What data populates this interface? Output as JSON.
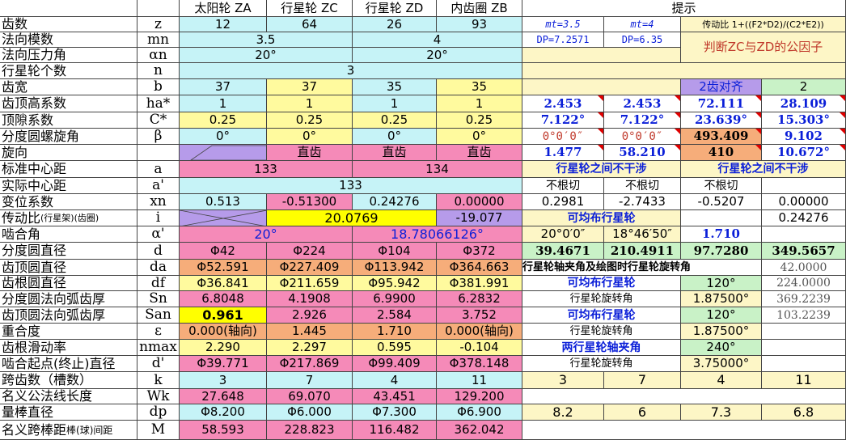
{
  "header": {
    "label": "",
    "symbol": "",
    "sun": "太阳轮 ZA",
    "planet_c": "行星轮 ZC",
    "planet_d": "行星轮 ZD",
    "ring": "内齿圈 ZB",
    "hint": "提示"
  },
  "params": {
    "z": {
      "label": "齿数",
      "symbol": "z",
      "sun": "12",
      "planet_c": "64",
      "planet_d": "26",
      "ring": "93"
    },
    "mn": {
      "label": "法向模数",
      "symbol": "mn",
      "v1": "3.5",
      "v2": "4"
    },
    "an": {
      "label": "法向压力角",
      "symbol": "αn",
      "v1": "20°",
      "v2": "20°"
    },
    "n": {
      "label": "行星轮个数",
      "symbol": "n",
      "v": "3"
    },
    "b": {
      "label": "齿宽",
      "symbol": "b",
      "sun": "37",
      "planet_c": "37",
      "planet_d": "35",
      "ring": "35"
    },
    "ha": {
      "label": "齿顶高系数",
      "symbol": "ha*",
      "sun": "1",
      "planet_c": "1",
      "planet_d": "1",
      "ring": "1"
    },
    "c": {
      "label": "顶隙系数",
      "symbol": "C*",
      "sun": "0.25",
      "planet_c": "0.25",
      "planet_d": "0.25",
      "ring": "0.25"
    },
    "beta": {
      "label": "分度圆螺旋角",
      "symbol": "β",
      "sun": "0°",
      "planet_c": "0°",
      "planet_d": "0°",
      "ring": "0°"
    },
    "dir": {
      "label": "旋向",
      "symbol": "",
      "planet_c": "直齿",
      "planet_d": "直齿",
      "ring": "直齿",
      "sun2": "直齿"
    },
    "a": {
      "label": "标准中心距",
      "symbol": "a",
      "v1": "133",
      "v2": "134"
    },
    "a2": {
      "label": "实际中心距",
      "symbol": "a'",
      "v": "133"
    },
    "xn": {
      "label": "变位系数",
      "symbol": "xn",
      "sun": "0.513",
      "planet_c": "-0.51300",
      "planet_d": "0.24276",
      "ring": "0.00000"
    },
    "i": {
      "label": "传动比",
      "label_small": "(行星架)(齿圈)",
      "symbol": "i",
      "v1": "20.0769",
      "v2": "-19.077"
    },
    "aw": {
      "label": "啮合角",
      "symbol": "α'",
      "v1": "20°",
      "v2": "18.78066126°"
    },
    "d": {
      "label": "分度圆直径",
      "symbol": "d",
      "sun": "Φ42",
      "planet_c": "Φ224",
      "planet_d": "Φ104",
      "ring": "Φ372"
    },
    "da": {
      "label": "齿顶圆直径",
      "symbol": "da",
      "sun": "Φ52.591",
      "planet_c": "Φ227.409",
      "planet_d": "Φ113.942",
      "ring": "Φ364.663"
    },
    "df": {
      "label": "齿根圆直径",
      "symbol": "df",
      "sun": "Φ36.841",
      "planet_c": "Φ211.659",
      "planet_d": "Φ95.942",
      "ring": "Φ381.991"
    },
    "sn": {
      "label": "分度圆法向弧齿厚",
      "symbol": "Sn",
      "sun": "6.8048",
      "planet_c": "4.1908",
      "planet_d": "6.9900",
      "ring": "6.2832"
    },
    "san": {
      "label": "齿顶圆法向弧齿厚",
      "symbol": "San",
      "sun": "0.961",
      "planet_c": "2.926",
      "planet_d": "2.584",
      "ring": "3.752"
    },
    "eps": {
      "label": "重合度",
      "symbol": "ε",
      "sun": "0.000(轴向)",
      "planet_c": "1.445",
      "planet_d": "1.710",
      "ring": "0.000(轴向)"
    },
    "nmax": {
      "label": "齿根滑动率",
      "symbol": "nmax",
      "sun": "2.290",
      "planet_c": "2.297",
      "planet_d": "0.595",
      "ring": "-0.104"
    },
    "dp": {
      "label": "啮合起点(终止)直径",
      "symbol": "d'",
      "sun": "Φ39.771",
      "planet_c": "Φ217.869",
      "planet_d": "Φ99.409",
      "ring": "Φ378.148"
    },
    "k": {
      "label": "跨齿数（槽数）",
      "symbol": "k",
      "sun": "3",
      "planet_c": "7",
      "planet_d": "4",
      "ring": "11"
    },
    "wk": {
      "label": "名义公法线长度",
      "symbol": "Wk",
      "sun": "27.648",
      "planet_c": "69.070",
      "planet_d": "43.451",
      "ring": "129.200"
    },
    "dpin": {
      "label": "量棒直径",
      "symbol": "dp",
      "sun": "Φ8.200",
      "planet_c": "Φ6.000",
      "planet_d": "Φ7.300",
      "ring": "Φ6.900"
    },
    "m": {
      "label": "名义跨棒距",
      "label_small": "棒(球)间距",
      "symbol": "M",
      "sun": "58.593",
      "planet_c": "228.823",
      "planet_d": "116.482",
      "ring": "362.042"
    }
  },
  "hints": {
    "mt1": "mt=3.5",
    "mt2": "mt=4",
    "ratio_formula": "传动比 1+((F2*D2)/(C2*E2))",
    "dp1": "DP=7.2571",
    "dp2": "DP=6.35",
    "judge": "判断ZC与ZD的公因子",
    "two_teeth": "2齿对齐",
    "two_teeth_val": "2",
    "r_ha": [
      "2.453",
      "2.453",
      "72.111",
      "28.109"
    ],
    "r_c": [
      "7.122°",
      "7.122°",
      "23.639°",
      "15.303°"
    ],
    "r_beta": [
      "0°0′0″",
      "0°0′0″",
      "493.409",
      "9.102"
    ],
    "r_dir": [
      "1.477",
      "58.210",
      "410",
      "10.672°"
    ],
    "no_interf_1": "行星轮之间不干涉",
    "no_interf_2": "行星轮之间不干涉",
    "no_undercut": [
      "不根切",
      "不根切",
      "不根切"
    ],
    "r_xn": [
      "0.2981",
      "-2.7433",
      "-0.5207",
      "0.00000"
    ],
    "even_1": "可均布行星轮",
    "r_i": "0.24276",
    "r_aw": [
      "20°0′0″",
      "18°46′50″",
      "1.710"
    ],
    "r_d": [
      "39.4671",
      "210.4911",
      "97.7280",
      "349.5657"
    ],
    "angle_title": "行星轮轴夹角及绘图时行星轮旋转角",
    "r_da": "42.0000",
    "even_2": "可均布行星轮",
    "r_df_a": "120°",
    "r_df_b": "224.0000",
    "rot_1": "行星轮旋转角",
    "r_sn_a": "1.87500°",
    "r_sn_b": "369.2239",
    "even_3": "可均布行星轮",
    "r_san_a": "120°",
    "r_san_b": "103.2239",
    "rot_2": "行星轮旋转角",
    "r_eps": "1.87500°",
    "axis_angle": "两行星轮轴夹角",
    "r_nmax": "240°",
    "rot_3": "行星轮旋转角",
    "r_dp": "3.75000°",
    "r_k": [
      "3",
      "7",
      "4",
      "11"
    ],
    "r_dpin": [
      "8.2",
      "6",
      "7.3",
      "6.8"
    ]
  },
  "colors": {
    "cyan": "#c6f3f7",
    "pink": "#f58ab8",
    "yellow": "#fffa9e",
    "orange": "#f6ad7a",
    "purple": "#b69bea",
    "green": "#c9f2c7",
    "bright_yellow": "#ffff00",
    "light_yellow": "#fdf6c6",
    "blue_text": "#0a1ed8"
  }
}
